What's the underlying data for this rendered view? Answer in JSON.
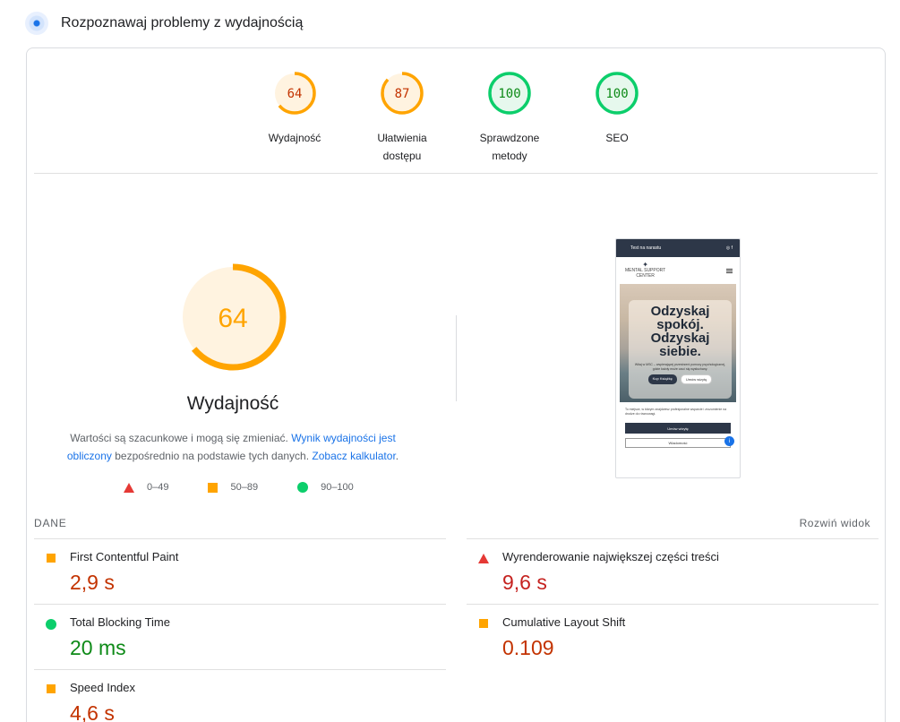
{
  "header": {
    "title": "Rozpoznawaj problemy z wydajnością",
    "icon": "lighthouse-icon"
  },
  "scores": [
    {
      "value": 64,
      "label_lines": [
        "Wydajność"
      ],
      "status": "average",
      "color": "#ffa400"
    },
    {
      "value": 87,
      "label_lines": [
        "Ułatwienia",
        "dostępu"
      ],
      "status": "average",
      "color": "#ffa400"
    },
    {
      "value": 100,
      "label_lines": [
        "Sprawdzone",
        "metody"
      ],
      "status": "pass",
      "color": "#0cce6b"
    },
    {
      "value": 100,
      "label_lines": [
        "SEO"
      ],
      "status": "pass",
      "color": "#0cce6b"
    }
  ],
  "performance": {
    "score": 64,
    "title": "Wydajność",
    "note_prefix": "Wartości są szacunkowe i mogą się zmieniać. ",
    "note_link1": "Wynik wydajności jest obliczony",
    "note_middle": " bezpośrednio na podstawie tych danych. ",
    "note_link2": "Zobacz kalkulator",
    "note_suffix": "."
  },
  "legend": [
    {
      "shape": "triangle",
      "label": "0–49",
      "color": "#e53935"
    },
    {
      "shape": "square",
      "label": "50–89",
      "color": "#ffa400"
    },
    {
      "shape": "circle",
      "label": "90–100",
      "color": "#0cce6b"
    }
  ],
  "thumbnail": {
    "top_bar": "Test na narastu",
    "logo_top": "MENTAL SUPPORT",
    "logo_bottom": "CENTER",
    "hero_heading": "Odzyskaj spokój. Odzyskaj siebie.",
    "hero_text": "Witaj w MSC – wspierającej przestrzeni pomocy psychologicznej, gdzie każdy może czuć się wysłuchany.",
    "btn_primary": "Kup Książkę",
    "btn_secondary": "Umów wizytę",
    "paragraph": "To miejsce, w którym znajdziesz profesjonalne wsparcie i zrozumienie na drodze do równowagi.",
    "cta_primary": "Umów wizytę",
    "cta_secondary": "Wiadomość",
    "fab_icon": "chat-icon"
  },
  "metrics_section": {
    "title": "DANE",
    "expand_label": "Rozwiń widok"
  },
  "metrics": [
    {
      "name": "First Contentful Paint",
      "value": "2,9 s",
      "status": "average"
    },
    {
      "name": "Wyrenderowanie największej części treści",
      "value": "9,6 s",
      "status": "fail"
    },
    {
      "name": "Total Blocking Time",
      "value": "20 ms",
      "status": "pass"
    },
    {
      "name": "Cumulative Layout Shift",
      "value": "0.109",
      "status": "average"
    },
    {
      "name": "Speed Index",
      "value": "4,6 s",
      "status": "average"
    }
  ]
}
